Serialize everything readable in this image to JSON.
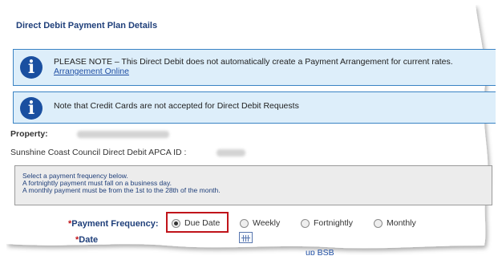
{
  "section": {
    "title": "Direct Debit Payment Plan Details"
  },
  "notices": [
    {
      "icon": "info-icon",
      "text": "PLEASE NOTE – This Direct Debit does not automatically create a Payment Arrangement for current rates.",
      "link": "Arrangement Online"
    },
    {
      "icon": "info-icon",
      "text": "Note that Credit Cards are not accepted for Direct Debit Requests"
    }
  ],
  "property": {
    "label": "Property:"
  },
  "apca": {
    "label": "Sunshine Coast Council Direct Debit APCA ID :"
  },
  "frequency_help": {
    "lines": [
      "Select a payment frequency below.",
      "A fortnightly payment must fall on a business day.",
      "A monthly payment must be from the 1st to the 28th of the month."
    ]
  },
  "payment_frequency": {
    "required_mark": "*",
    "label": "Payment Frequency:",
    "options": [
      {
        "label": "Due Date",
        "checked": true
      },
      {
        "label": "Weekly",
        "checked": false
      },
      {
        "label": "Fortnightly",
        "checked": false
      },
      {
        "label": "Monthly",
        "checked": false
      }
    ]
  },
  "date_field": {
    "required_mark": "*",
    "label": "Date",
    "icon": "calendar-icon"
  },
  "bsb": {
    "text": "up BSB"
  },
  "colors": {
    "title_blue": "#1f3f7a",
    "notice_bg": "#ddeefa",
    "notice_border": "#3a83c4",
    "info_icon": "#1a4fa0",
    "highlight_red": "#c0141a",
    "link_blue": "#1f4ea3"
  }
}
